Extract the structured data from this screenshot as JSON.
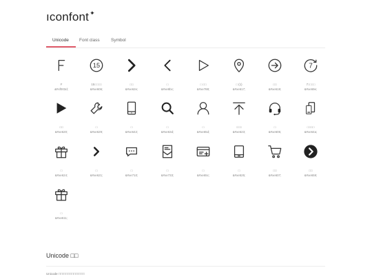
{
  "brand": {
    "name": "ıconfont",
    "mark": "✦"
  },
  "tabs": [
    {
      "label": "Unicode",
      "active": true
    },
    {
      "label": "Font class",
      "active": false
    },
    {
      "label": "Symbol",
      "active": false
    }
  ],
  "icons": [
    {
      "icon": "letter-f-icon",
      "name": "F",
      "code": "&#xf003d;"
    },
    {
      "icon": "fifteen-circle-icon",
      "glyph": "15",
      "name": "15□□□□",
      "code": "&#xe606;"
    },
    {
      "icon": "chevron-right-bold-icon",
      "name": "□□",
      "code": "&#xe62e;"
    },
    {
      "icon": "chevron-left-icon",
      "name": "□",
      "code": "&#xe8bc;"
    },
    {
      "icon": "play-outline-icon",
      "name": "□ □□",
      "code": "&#xe788;"
    },
    {
      "icon": "location-pin-icon",
      "name": "□ (1)",
      "code": "&#xe617;"
    },
    {
      "icon": "arrow-right-circle-icon",
      "name": "□□",
      "code": "&#xe619;"
    },
    {
      "icon": "seven-circle-icon",
      "glyph": "7",
      "name": "7□□□□",
      "code": "&#xe69e;"
    },
    {
      "icon": "play-filled-icon",
      "name": "□□",
      "code": "&#xe620;"
    },
    {
      "icon": "wrench-icon",
      "name": "□",
      "code": "&#xe629;"
    },
    {
      "icon": "phone-icon",
      "name": "□",
      "code": "&#xe642;"
    },
    {
      "icon": "search-icon",
      "name": "□",
      "code": "&#xe63d;"
    },
    {
      "icon": "user-icon",
      "name": "□",
      "code": "&#xe65d;"
    },
    {
      "icon": "arrow-up-top-icon",
      "name": "□□□",
      "code": "&#xe623;"
    },
    {
      "icon": "headset-icon",
      "name": "□",
      "code": "&#xe605;"
    },
    {
      "icon": "devices-icon",
      "name": "□□□□",
      "code": "&#xe64a;"
    },
    {
      "icon": "gift-icon",
      "name": "□",
      "code": "&#xe624;"
    },
    {
      "icon": "chevron-right-small-icon",
      "name": "□",
      "code": "&#xe621;"
    },
    {
      "icon": "chat-bubble-icon",
      "name": "□",
      "code": "&#xe710;"
    },
    {
      "icon": "envelope-doc-icon",
      "name": "□",
      "code": "&#xe733;"
    },
    {
      "icon": "card-add-icon",
      "name": "□",
      "code": "&#xe65c;"
    },
    {
      "icon": "tablet-icon",
      "name": "□",
      "code": "&#xe525;"
    },
    {
      "icon": "cart-icon",
      "name": "□□",
      "code": "&#xe607;"
    },
    {
      "icon": "chevron-circle-filled-icon",
      "name": "□□",
      "code": "&#xe659;"
    },
    {
      "icon": "gift-icon",
      "name": "□",
      "code": "&#xe611;"
    }
  ],
  "section": {
    "title": "Unicode □□"
  },
  "note": {
    "text": "Unicode □□□□□□□□□□□□□□"
  }
}
